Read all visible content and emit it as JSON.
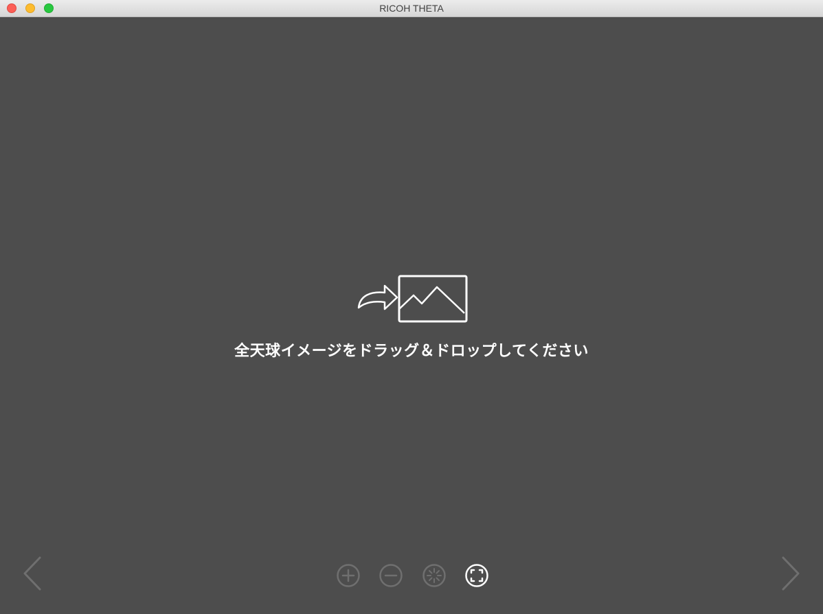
{
  "window": {
    "title": "RICOH THETA",
    "controls": [
      "close",
      "minimize",
      "zoom"
    ]
  },
  "drop_zone": {
    "icon": "drag-drop-image-icon",
    "message": "全天球イメージをドラッグ＆ドロップしてください"
  },
  "navigation": {
    "previous_icon": "chevron-left-icon",
    "next_icon": "chevron-right-icon"
  },
  "toolbar": {
    "buttons": [
      {
        "icon": "zoom-in-icon",
        "enabled": false
      },
      {
        "icon": "zoom-out-icon",
        "enabled": false
      },
      {
        "icon": "reset-spinner-icon",
        "enabled": false
      },
      {
        "icon": "fullscreen-icon",
        "enabled": true
      }
    ]
  },
  "colors": {
    "background": "#4d4d4d",
    "foreground": "#ffffff",
    "disabled": "#6f6f6f",
    "close": "#fc5f57",
    "minimize": "#fdbc2e",
    "zoom": "#28c840"
  }
}
